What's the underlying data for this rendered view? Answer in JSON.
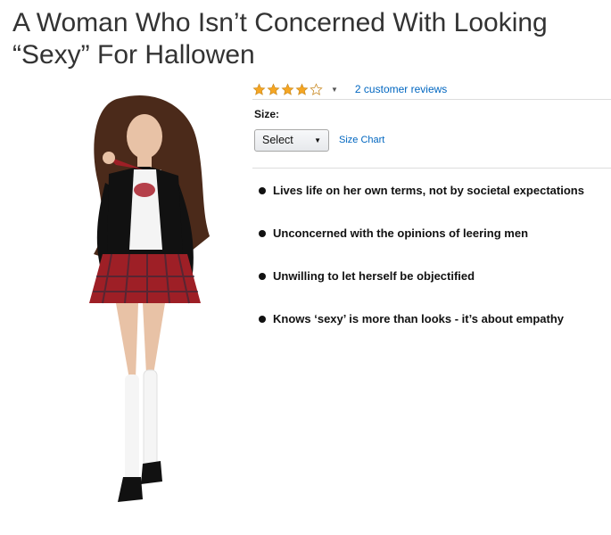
{
  "headline": {
    "line1": "A Woman Who Isn’t Concerned With Looking",
    "line2": "“Sexy” For Hallowen"
  },
  "product": {
    "image_icon": "costume-photo",
    "colors": {
      "jacket": "#111111",
      "skirt": "#9e1f26",
      "skin": "#e8c2a6",
      "hair": "#4b2a1a",
      "socks": "#f5f5f5"
    }
  },
  "rating": {
    "value": 4,
    "max": 5,
    "star_color": "#f5a623",
    "reviews_label": "2 customer reviews"
  },
  "size": {
    "label": "Size:",
    "select_value": "Select",
    "size_chart_label": "Size Chart"
  },
  "bullets": [
    "Lives life on her own terms, not by societal expectations",
    "Unconcerned with the opinions of leering men",
    "Unwilling to let herself be objectified",
    "Knows ‘sexy’ is more than looks - it’s about empathy"
  ],
  "colors": {
    "link": "#0066c0",
    "divider": "#dddddd",
    "headline": "#333333"
  }
}
